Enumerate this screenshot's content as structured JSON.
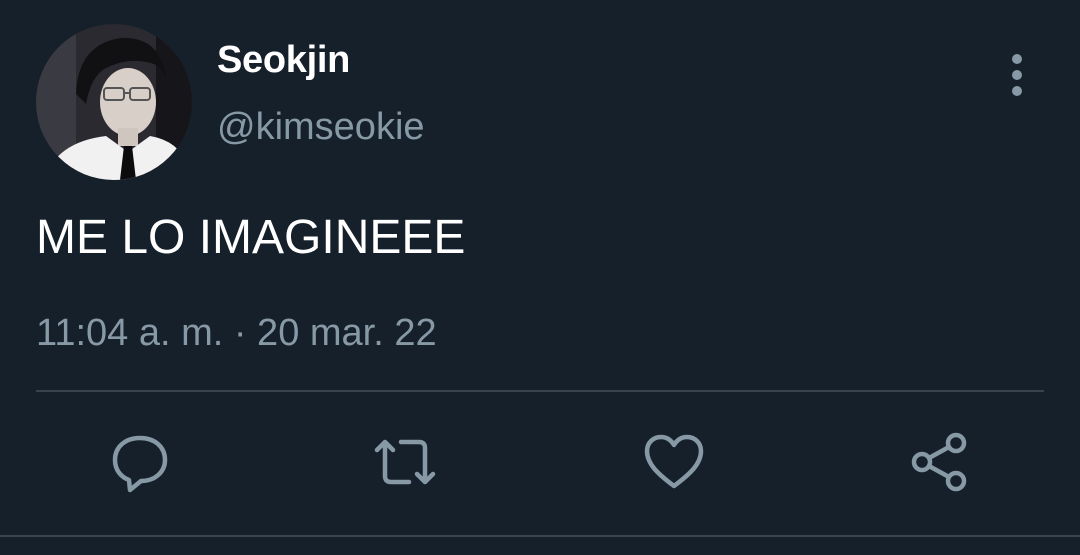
{
  "tweet": {
    "author": {
      "display_name": "Seokjin",
      "handle": "@kimseokie",
      "avatar_icon": "profile-photo"
    },
    "text": "ME LO IMAGINEEE",
    "timestamp": "11:04 a. m. · 20 mar. 22",
    "more_icon": "more-vertical-icon"
  },
  "actions": [
    {
      "name": "reply",
      "icon": "reply-icon"
    },
    {
      "name": "retweet",
      "icon": "retweet-icon"
    },
    {
      "name": "like",
      "icon": "heart-icon"
    },
    {
      "name": "share",
      "icon": "share-icon"
    }
  ],
  "colors": {
    "background": "#15202b",
    "primary_text": "#ffffff",
    "secondary_text": "#8899a6",
    "divider": "#38444d"
  }
}
